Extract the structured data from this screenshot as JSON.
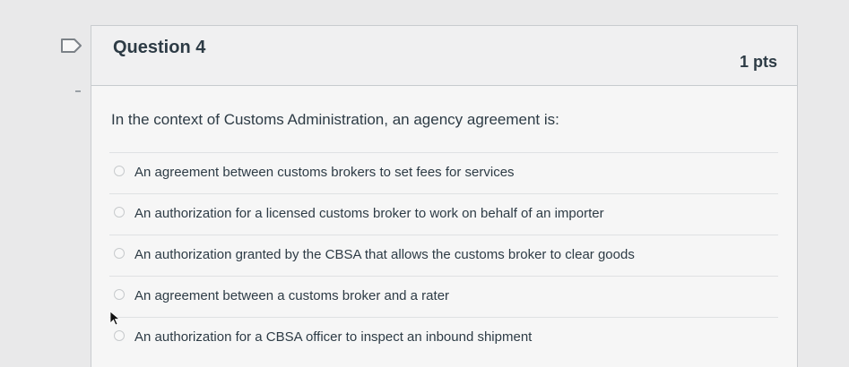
{
  "question": {
    "title": "Question 4",
    "points": "1 pts",
    "text": "In the context of Customs Administration, an agency agreement is:"
  },
  "answers": [
    {
      "label": "An agreement between customs brokers to set fees for services"
    },
    {
      "label": "An authorization for a licensed customs broker to work on behalf of an importer"
    },
    {
      "label": "An authorization granted by the CBSA that allows the customs broker to clear goods"
    },
    {
      "label": "An agreement between a customs broker and a rater"
    },
    {
      "label": "An authorization for a CBSA officer to inspect an inbound shipment"
    }
  ],
  "icons": {
    "flag": "flag-icon",
    "radio": "radio-icon",
    "cursor": "mouse-pointer-icon"
  }
}
